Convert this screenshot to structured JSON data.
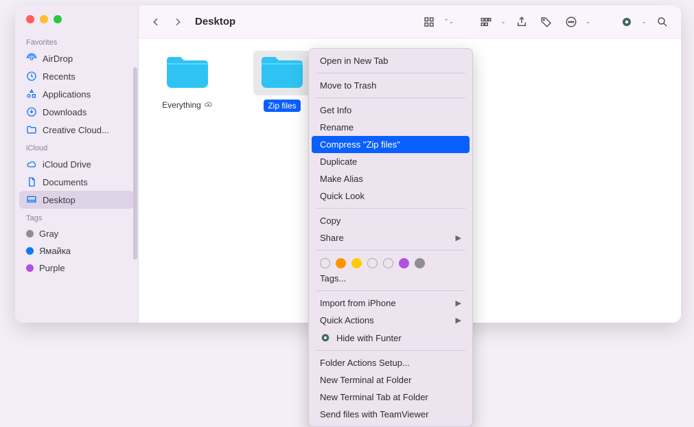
{
  "window": {
    "title": "Desktop"
  },
  "sidebar": {
    "sections": {
      "favorites": "Favorites",
      "icloud": "iCloud",
      "tags": "Tags"
    },
    "favorites": [
      {
        "label": "AirDrop"
      },
      {
        "label": "Recents"
      },
      {
        "label": "Applications"
      },
      {
        "label": "Downloads"
      },
      {
        "label": "Creative Cloud..."
      }
    ],
    "icloud": [
      {
        "label": "iCloud Drive"
      },
      {
        "label": "Documents"
      },
      {
        "label": "Desktop",
        "selected": true
      }
    ],
    "tags": [
      {
        "label": "Gray",
        "color": "#8e8e93"
      },
      {
        "label": "Ямайка",
        "color": "#0a7aff"
      },
      {
        "label": "Purple",
        "color": "#af52de"
      }
    ]
  },
  "files": [
    {
      "name": "Everything",
      "cloud": true,
      "selected": false
    },
    {
      "name": "Zip files",
      "cloud": false,
      "selected": true
    }
  ],
  "context_menu": {
    "groups": [
      [
        {
          "label": "Open in New Tab"
        }
      ],
      [
        {
          "label": "Move to Trash"
        }
      ],
      [
        {
          "label": "Get Info"
        },
        {
          "label": "Rename"
        },
        {
          "label": "Compress \"Zip files\"",
          "highlighted": true
        },
        {
          "label": "Duplicate"
        },
        {
          "label": "Make Alias"
        },
        {
          "label": "Quick Look"
        }
      ],
      [
        {
          "label": "Copy"
        },
        {
          "label": "Share",
          "submenu": true
        }
      ],
      "tags",
      [
        {
          "label": "Tags..."
        }
      ],
      [
        {
          "label": "Import from iPhone",
          "submenu": true
        },
        {
          "label": "Quick Actions",
          "submenu": true
        },
        {
          "label": "Hide with Funter",
          "icon": "funter"
        }
      ],
      [
        {
          "label": "Folder Actions Setup..."
        },
        {
          "label": "New Terminal at Folder"
        },
        {
          "label": "New Terminal Tab at Folder"
        },
        {
          "label": "Send files with TeamViewer"
        }
      ]
    ],
    "tag_colors": [
      "empty",
      "#ff9500",
      "#ffcc00",
      "empty",
      "empty",
      "#af52de",
      "#8e8e93"
    ]
  }
}
